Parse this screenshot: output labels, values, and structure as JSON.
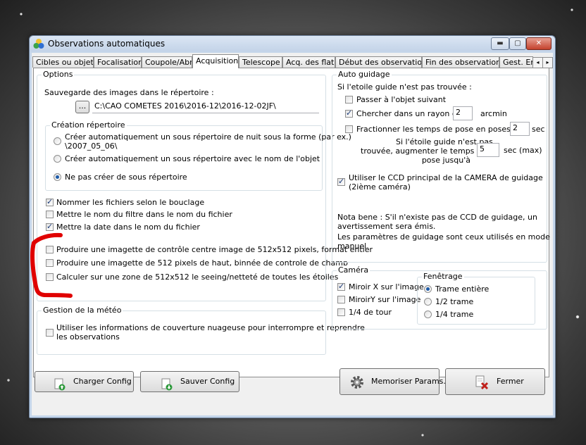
{
  "window": {
    "title": "Observations automatiques",
    "controls": {
      "minimize": "▬",
      "maximize": "▢",
      "close": "✕"
    }
  },
  "tabs": [
    {
      "label": "Cibles ou objets",
      "active": false
    },
    {
      "label": "Focalisation",
      "active": false
    },
    {
      "label": "Coupole/Abri",
      "active": false
    },
    {
      "label": "Acquisition",
      "active": true
    },
    {
      "label": "Telescope",
      "active": false
    },
    {
      "label": "Acq. des flats",
      "active": false
    },
    {
      "label": "Début des observations",
      "active": false
    },
    {
      "label": "Fin des observations",
      "active": false
    },
    {
      "label": "Gest. Er",
      "active": false
    }
  ],
  "tab_scroll": {
    "left": "◂",
    "right": "▸"
  },
  "options": {
    "title": "Options",
    "save_label": "Sauvegarde des images dans le répertoire :",
    "browse_label": "...",
    "save_path": "C:\\CAO COMETES 2016\\2016-12\\2016-12-02JF\\",
    "creation": {
      "title": "Création répertoire",
      "radio1_line1": "Créer automatiquement un sous répertoire de nuit sous la forme (par ex.)",
      "radio1_line2": "\\2007_05_06\\",
      "radio2": "Créer automatiquement un sous répertoire avec le nom de l'objet",
      "radio3": "Ne pas créer de sous répertoire"
    },
    "cb_bouclage": "Nommer les fichiers selon le bouclage",
    "cb_filtre": "Mettre le nom du filtre dans le nom du fichier",
    "cb_date": "Mettre la date dans le nom du fichier",
    "cb_imagette1": "Produire une imagette de contrôle centre image de 512x512 pixels, format entier",
    "cb_imagette2": "Produire une imagette de 512 pixels de haut, binnée de controle de champ",
    "cb_seeing": "Calculer sur une zone de 512x512 le seeing/netteté de toutes les étoiles"
  },
  "meteo": {
    "title": "Gestion de la météo",
    "cb_line1": "Utiliser les informations de couverture nuageuse pour interrompre et reprendre",
    "cb_line2": "les observations"
  },
  "autoguide": {
    "title": "Auto guidage",
    "not_found": "Si l'etoile guide n'est pas trouvée :",
    "cb_next": "Passer à l'objet suivant",
    "cb_search": "Chercher dans un rayon de",
    "search_value": "2",
    "search_unit": "arcmin",
    "cb_split": "Fractionner les temps de pose en poses de",
    "split_value": "2",
    "split_unit": "sec",
    "increase_line1": "Si l'étoile guide n'est pas",
    "increase_line2": "trouvée, augmenter le temps de",
    "increase_line3": "pose jusqu'à",
    "increase_value": "5",
    "increase_unit": "sec (max)",
    "cb_ccd_line1": "Utiliser le CCD principal de la CAMERA de guidage",
    "cb_ccd_line2": "(2ième caméra)",
    "note_line1": "Nota bene : S'il n'existe pas de CCD de guidage, un",
    "note_line2": "avertissement sera émis.",
    "note_line3": "Les paramètres de guidage sont ceux utilisés en mode",
    "note_line4": "manuel."
  },
  "camera": {
    "title": "Caméra",
    "cb_mirrorx": "Miroir X sur l'image",
    "cb_mirrory": "MiroirY sur l'image",
    "cb_quarter": "1/4 de tour",
    "fenetrage": {
      "title": "Fenêtrage",
      "r_full": "Trame entière",
      "r_half": "1/2 trame",
      "r_quarter": "1/4 trame"
    }
  },
  "buttons": {
    "load": "Charger Config",
    "save": "Sauver Config",
    "memo": "Memoriser Params.",
    "close": "Fermer"
  },
  "colors": {
    "annotation": "#e00000",
    "accent": "#1c5aa8"
  }
}
